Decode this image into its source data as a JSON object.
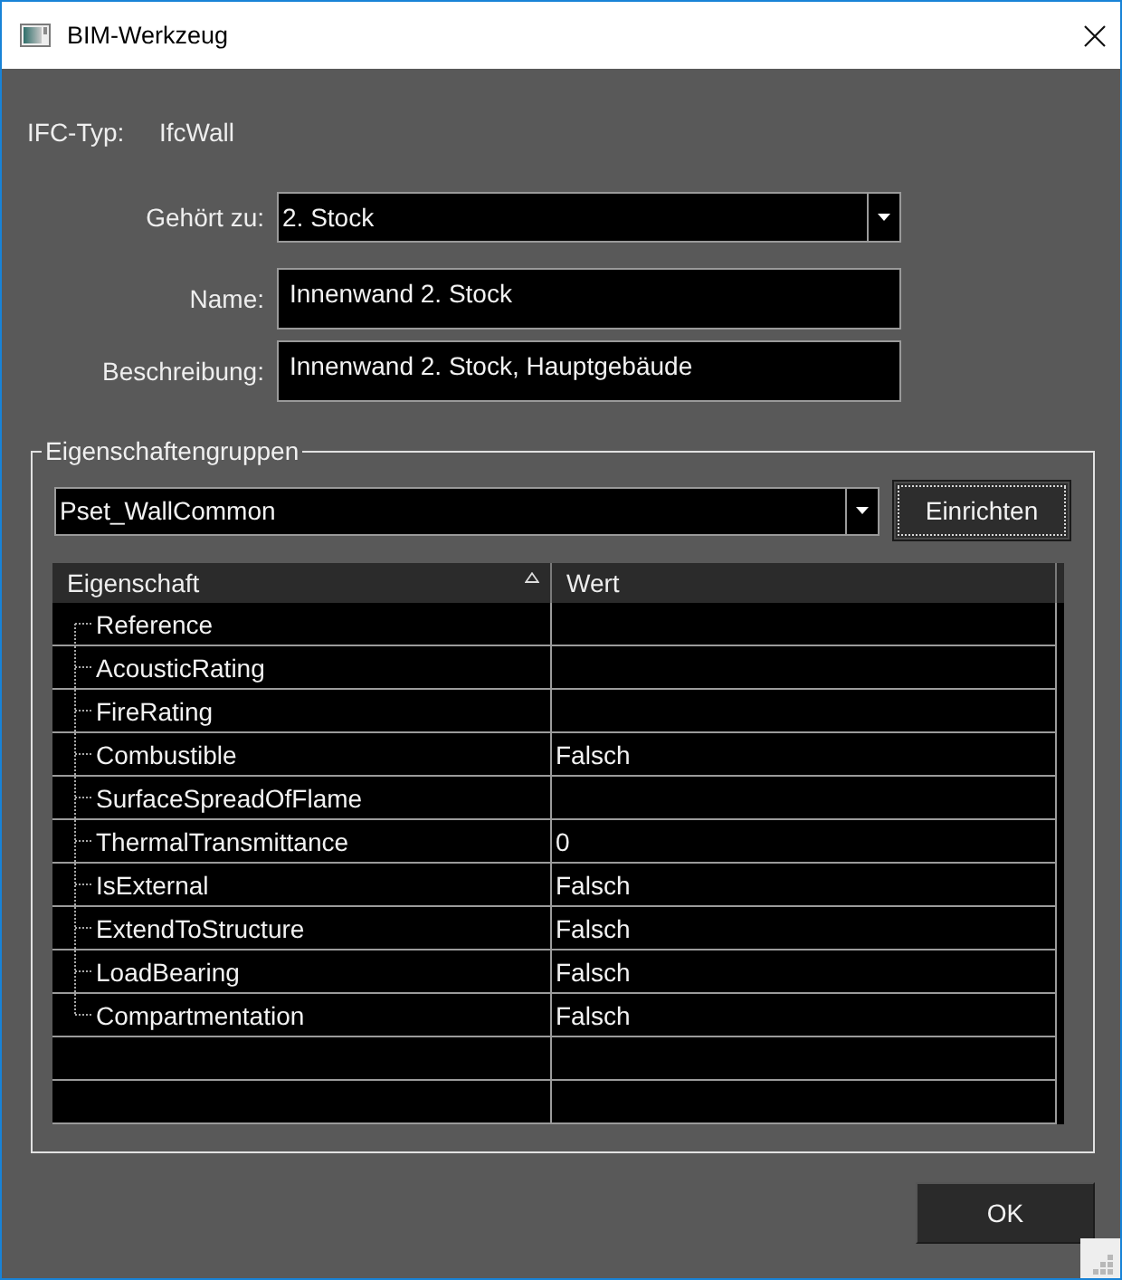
{
  "window": {
    "title": "BIM-Werkzeug"
  },
  "ifc_type": {
    "label": "IFC-Typ:",
    "value": "IfcWall"
  },
  "fields": [
    {
      "kind": "dropdown",
      "label": "Gehört zu:",
      "value": "2. Stock"
    },
    {
      "kind": "text",
      "label": "Name:",
      "value": "Innenwand 2. Stock"
    },
    {
      "kind": "text",
      "label": "Beschreibung:",
      "value": "Innenwand 2. Stock, Hauptgebäude"
    }
  ],
  "property_groups": {
    "title": "Eigenschaftengruppen",
    "pset_dropdown": {
      "value": "Pset_WallCommon"
    },
    "setup_button": {
      "label": "Einrichten",
      "focused": true
    },
    "table": {
      "columns": [
        {
          "label": "Eigenschaft",
          "sorted": true
        },
        {
          "label": "Wert",
          "sorted": false
        }
      ],
      "rows": [
        {
          "property": "Reference"
        },
        {
          "property": "AcousticRating"
        },
        {
          "property": "FireRating"
        },
        {
          "property": "Combustible",
          "value": "Falsch"
        },
        {
          "property": "SurfaceSpreadOfFlame"
        },
        {
          "property": "ThermalTransmittance",
          "value": "0"
        },
        {
          "property": "IsExternal",
          "value": "Falsch"
        },
        {
          "property": "ExtendToStructure",
          "value": "Falsch"
        },
        {
          "property": "LoadBearing",
          "value": "Falsch"
        },
        {
          "property": "Compartmentation",
          "value": "Falsch"
        }
      ]
    }
  },
  "buttons": [
    {
      "label": "OK"
    }
  ]
}
